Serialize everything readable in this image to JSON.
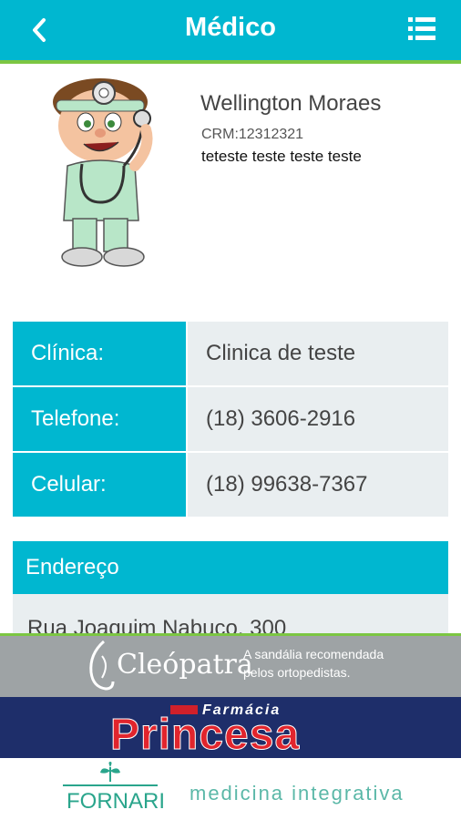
{
  "header": {
    "title": "Médico",
    "back_icon": "chevron-left-icon",
    "menu_icon": "list-menu-icon",
    "bar_color": "#00B7D0",
    "accent_line_color": "#7CC642"
  },
  "doctor": {
    "name": "Wellington Moraes",
    "crm": "CRM:12312321",
    "description": "teteste teste teste teste",
    "avatar": "doctor-cartoon-avatar"
  },
  "info": {
    "rows": [
      {
        "label": "Clínica:",
        "value": "Clinica de teste"
      },
      {
        "label": "Telefone:",
        "value": "(18) 3606-2916"
      },
      {
        "label": "Celular:",
        "value": "(18) 99638-7367"
      }
    ]
  },
  "address": {
    "header": "Endereço",
    "text": "Rua  Joaquim Nabuco, 300"
  },
  "ads": {
    "cleopatra": {
      "brand": "Cleópatra",
      "tagline_1": "A sandália recomendada",
      "tagline_2": "pelos ortopedistas."
    },
    "princesa": {
      "small": "Farmácia",
      "big": "Princesa"
    },
    "fornari": {
      "name": "FORNARI",
      "tagline": "medicina integrativa"
    }
  }
}
